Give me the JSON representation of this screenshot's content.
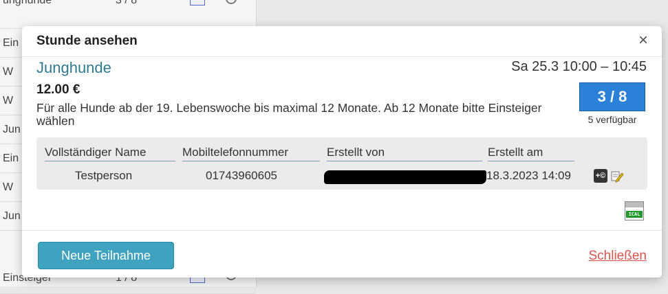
{
  "background_list": {
    "rows": [
      {
        "name": "unghunde",
        "count": "3 / 8"
      },
      {
        "name": "Ein",
        "count": ""
      },
      {
        "name": "W",
        "count": ""
      },
      {
        "name": "W",
        "count": ""
      },
      {
        "name": "Jun",
        "count": ""
      },
      {
        "name": "Ein",
        "count": ""
      },
      {
        "name": "W",
        "count": ""
      },
      {
        "name": "Jun",
        "count": ""
      },
      {
        "name": "Einsteiger",
        "count": "1 / 8"
      }
    ]
  },
  "modal": {
    "title": "Stunde ansehen",
    "close_symbol": "×",
    "course_name": "Junghunde",
    "datetime": "Sa 25.3  10:00 – 10:45",
    "price": "12.00 €",
    "capacity": "3 / 8",
    "available": "5 verfügbar",
    "description": "Für alle Hunde ab der 19. Lebenswoche bis maximal 12 Monate. Ab 12 Monate bitte Einsteiger wählen",
    "table": {
      "headers": [
        "Vollständiger Name",
        "Mobiltelefonnummer",
        "Erstellt von",
        "Erstellt am"
      ],
      "rows": [
        {
          "name": "Testperson",
          "phone": "01743960605",
          "created_by": "",
          "created_at": "18.3.2023 14:09"
        }
      ]
    },
    "icons": {
      "flag": "flag-icon",
      "edit": "edit-icon",
      "ical": "ical-icon"
    },
    "ical_label": "ICAL",
    "flag_label": "+©",
    "footer": {
      "primary_button": "Neue Teilnahme",
      "close_link": "Schließen"
    }
  },
  "colors": {
    "accent": "#2f7a8c",
    "capacity_bg": "#2b80d8",
    "button_bg": "#3fa3c0",
    "close_link": "#d9534f"
  }
}
